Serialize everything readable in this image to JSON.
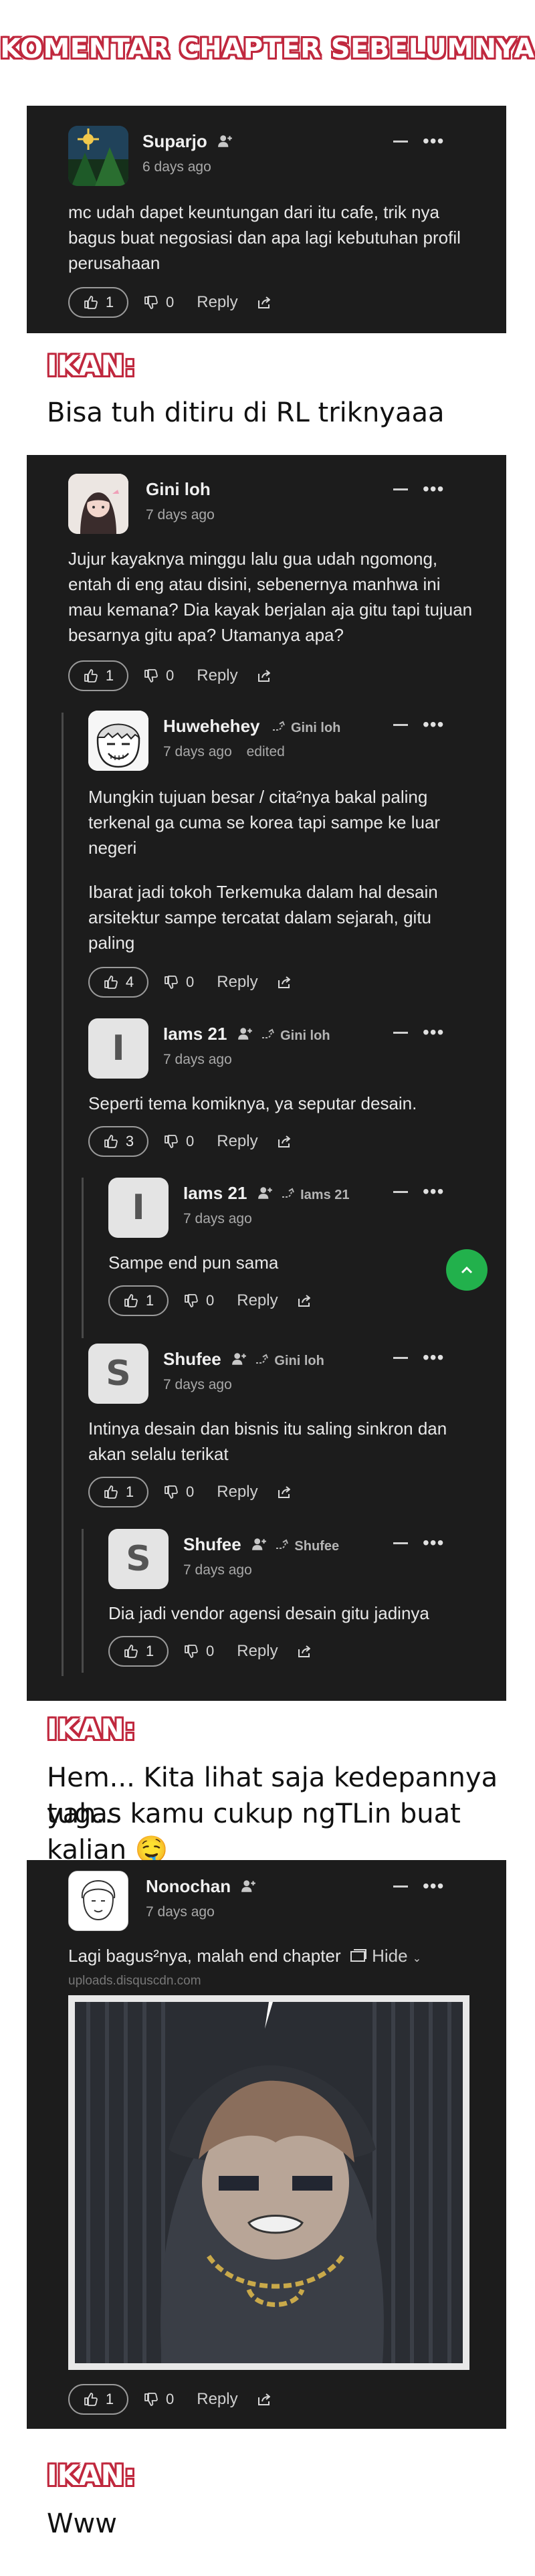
{
  "header": {
    "title": "KOMENTAR CHAPTER SEBELUMNYA"
  },
  "comment1": {
    "user": "Suparjo",
    "time": "6 days ago",
    "body": "mc udah dapet keuntungan dari itu cafe, trik nya bagus buat negosiasi dan apa lagi kebutuhan profil perusahaan",
    "likes": "1",
    "dislikes": "0",
    "reply": "Reply"
  },
  "ikan1": {
    "label": "IKAN:",
    "text": "Bisa tuh ditiru di RL triknyaaa"
  },
  "comment2": {
    "user": "Gini loh",
    "time": "7 days ago",
    "body": "Jujur kayaknya minggu lalu gua udah ngomong, entah di eng atau disini, sebenernya manhwa ini mau kemana? Dia kayak berjalan aja gitu tapi tujuan besarnya gitu apa? Utamanya apa?",
    "likes": "1",
    "dislikes": "0",
    "reply": "Reply"
  },
  "comment3": {
    "user": "Huwehehey",
    "reply_to": "Gini loh",
    "time": "7 days ago",
    "edited": "edited",
    "body1": "Mungkin tujuan besar / cita²nya bakal paling terkenal ga cuma se korea tapi sampe ke luar negeri",
    "body2": "Ibarat jadi tokoh Terkemuka dalam hal desain arsitektur sampe tercatat dalam sejarah, gitu paling",
    "likes": "4",
    "dislikes": "0",
    "reply": "Reply"
  },
  "comment4": {
    "user": "Iams 21",
    "avatar_letter": "I",
    "reply_to": "Gini loh",
    "time": "7 days ago",
    "body": "Seperti tema komiknya, ya seputar desain.",
    "likes": "3",
    "dislikes": "0",
    "reply": "Reply"
  },
  "comment5": {
    "user": "Iams 21",
    "avatar_letter": "I",
    "reply_to": "Iams 21",
    "time": "7 days ago",
    "body": "Sampe end pun sama",
    "likes": "1",
    "dislikes": "0",
    "reply": "Reply"
  },
  "comment6": {
    "user": "Shufee",
    "avatar_letter": "S",
    "reply_to": "Gini loh",
    "time": "7 days ago",
    "body": "Intinya desain dan bisnis itu saling sinkron dan akan selalu terikat",
    "likes": "1",
    "dislikes": "0",
    "reply": "Reply"
  },
  "comment7": {
    "user": "Shufee",
    "avatar_letter": "S",
    "reply_to": "Shufee",
    "time": "7 days ago",
    "body": "Dia jadi vendor agensi desain gitu jadinya",
    "likes": "1",
    "dislikes": "0",
    "reply": "Reply"
  },
  "ikan2": {
    "label": "IKAN:",
    "line1": "Hem... Kita lihat saja kedepannya yah..",
    "line2": "tugas kamu cukup ngTLin buat kalian 🤤"
  },
  "comment8": {
    "user": "Nonochan",
    "time": "7 days ago",
    "body": "Lagi bagus²nya, malah end chapter",
    "hide": "Hide",
    "image_source": "uploads.disquscdn.com",
    "likes": "1",
    "dislikes": "0",
    "reply": "Reply"
  },
  "ikan3": {
    "label": "IKAN:",
    "text": "Www"
  },
  "colors": {
    "panel": "#1c1c1c",
    "accent": "#c0283e",
    "fab": "#22b14c"
  }
}
